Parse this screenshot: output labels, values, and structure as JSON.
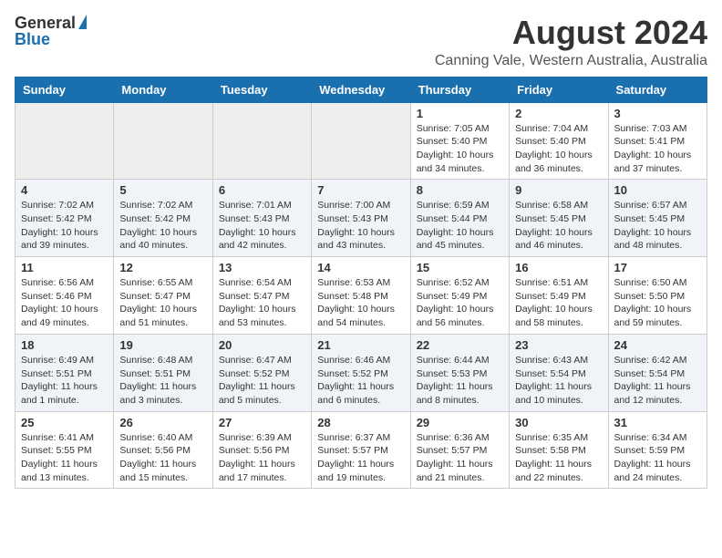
{
  "header": {
    "logo_general": "General",
    "logo_blue": "Blue",
    "title": "August 2024",
    "subtitle": "Canning Vale, Western Australia, Australia"
  },
  "days_of_week": [
    "Sunday",
    "Monday",
    "Tuesday",
    "Wednesday",
    "Thursday",
    "Friday",
    "Saturday"
  ],
  "weeks": [
    [
      {
        "day": "",
        "info": ""
      },
      {
        "day": "",
        "info": ""
      },
      {
        "day": "",
        "info": ""
      },
      {
        "day": "",
        "info": ""
      },
      {
        "day": "1",
        "info": "Sunrise: 7:05 AM\nSunset: 5:40 PM\nDaylight: 10 hours\nand 34 minutes."
      },
      {
        "day": "2",
        "info": "Sunrise: 7:04 AM\nSunset: 5:40 PM\nDaylight: 10 hours\nand 36 minutes."
      },
      {
        "day": "3",
        "info": "Sunrise: 7:03 AM\nSunset: 5:41 PM\nDaylight: 10 hours\nand 37 minutes."
      }
    ],
    [
      {
        "day": "4",
        "info": "Sunrise: 7:02 AM\nSunset: 5:42 PM\nDaylight: 10 hours\nand 39 minutes."
      },
      {
        "day": "5",
        "info": "Sunrise: 7:02 AM\nSunset: 5:42 PM\nDaylight: 10 hours\nand 40 minutes."
      },
      {
        "day": "6",
        "info": "Sunrise: 7:01 AM\nSunset: 5:43 PM\nDaylight: 10 hours\nand 42 minutes."
      },
      {
        "day": "7",
        "info": "Sunrise: 7:00 AM\nSunset: 5:43 PM\nDaylight: 10 hours\nand 43 minutes."
      },
      {
        "day": "8",
        "info": "Sunrise: 6:59 AM\nSunset: 5:44 PM\nDaylight: 10 hours\nand 45 minutes."
      },
      {
        "day": "9",
        "info": "Sunrise: 6:58 AM\nSunset: 5:45 PM\nDaylight: 10 hours\nand 46 minutes."
      },
      {
        "day": "10",
        "info": "Sunrise: 6:57 AM\nSunset: 5:45 PM\nDaylight: 10 hours\nand 48 minutes."
      }
    ],
    [
      {
        "day": "11",
        "info": "Sunrise: 6:56 AM\nSunset: 5:46 PM\nDaylight: 10 hours\nand 49 minutes."
      },
      {
        "day": "12",
        "info": "Sunrise: 6:55 AM\nSunset: 5:47 PM\nDaylight: 10 hours\nand 51 minutes."
      },
      {
        "day": "13",
        "info": "Sunrise: 6:54 AM\nSunset: 5:47 PM\nDaylight: 10 hours\nand 53 minutes."
      },
      {
        "day": "14",
        "info": "Sunrise: 6:53 AM\nSunset: 5:48 PM\nDaylight: 10 hours\nand 54 minutes."
      },
      {
        "day": "15",
        "info": "Sunrise: 6:52 AM\nSunset: 5:49 PM\nDaylight: 10 hours\nand 56 minutes."
      },
      {
        "day": "16",
        "info": "Sunrise: 6:51 AM\nSunset: 5:49 PM\nDaylight: 10 hours\nand 58 minutes."
      },
      {
        "day": "17",
        "info": "Sunrise: 6:50 AM\nSunset: 5:50 PM\nDaylight: 10 hours\nand 59 minutes."
      }
    ],
    [
      {
        "day": "18",
        "info": "Sunrise: 6:49 AM\nSunset: 5:51 PM\nDaylight: 11 hours\nand 1 minute."
      },
      {
        "day": "19",
        "info": "Sunrise: 6:48 AM\nSunset: 5:51 PM\nDaylight: 11 hours\nand 3 minutes."
      },
      {
        "day": "20",
        "info": "Sunrise: 6:47 AM\nSunset: 5:52 PM\nDaylight: 11 hours\nand 5 minutes."
      },
      {
        "day": "21",
        "info": "Sunrise: 6:46 AM\nSunset: 5:52 PM\nDaylight: 11 hours\nand 6 minutes."
      },
      {
        "day": "22",
        "info": "Sunrise: 6:44 AM\nSunset: 5:53 PM\nDaylight: 11 hours\nand 8 minutes."
      },
      {
        "day": "23",
        "info": "Sunrise: 6:43 AM\nSunset: 5:54 PM\nDaylight: 11 hours\nand 10 minutes."
      },
      {
        "day": "24",
        "info": "Sunrise: 6:42 AM\nSunset: 5:54 PM\nDaylight: 11 hours\nand 12 minutes."
      }
    ],
    [
      {
        "day": "25",
        "info": "Sunrise: 6:41 AM\nSunset: 5:55 PM\nDaylight: 11 hours\nand 13 minutes."
      },
      {
        "day": "26",
        "info": "Sunrise: 6:40 AM\nSunset: 5:56 PM\nDaylight: 11 hours\nand 15 minutes."
      },
      {
        "day": "27",
        "info": "Sunrise: 6:39 AM\nSunset: 5:56 PM\nDaylight: 11 hours\nand 17 minutes."
      },
      {
        "day": "28",
        "info": "Sunrise: 6:37 AM\nSunset: 5:57 PM\nDaylight: 11 hours\nand 19 minutes."
      },
      {
        "day": "29",
        "info": "Sunrise: 6:36 AM\nSunset: 5:57 PM\nDaylight: 11 hours\nand 21 minutes."
      },
      {
        "day": "30",
        "info": "Sunrise: 6:35 AM\nSunset: 5:58 PM\nDaylight: 11 hours\nand 22 minutes."
      },
      {
        "day": "31",
        "info": "Sunrise: 6:34 AM\nSunset: 5:59 PM\nDaylight: 11 hours\nand 24 minutes."
      }
    ]
  ]
}
